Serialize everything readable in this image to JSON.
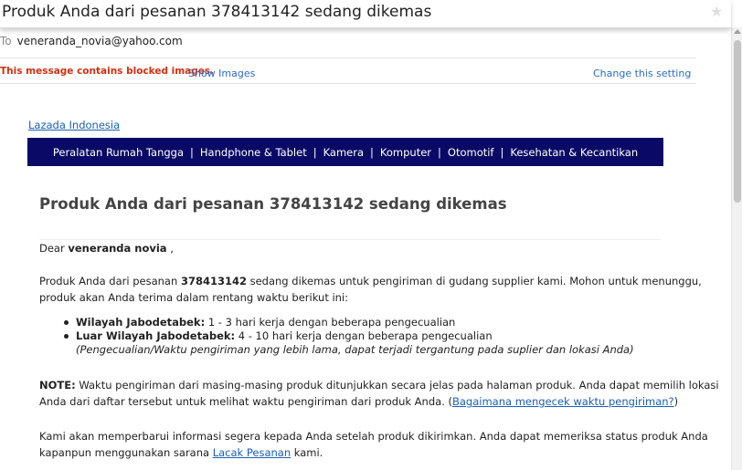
{
  "header": {
    "subject": "Produk Anda dari pesanan 378413142 sedang dikemas"
  },
  "meta": {
    "to_label": "To",
    "to_address": "veneranda_novia@yahoo.com",
    "blocked_message": "This message contains blocked images.",
    "show_images": "Show Images",
    "change_setting": "Change this setting"
  },
  "email": {
    "brand_link": "Lazada Indonesia",
    "nav": [
      "Peralatan Rumah Tangga",
      "Handphone & Tablet",
      "Kamera",
      "Komputer",
      "Otomotif",
      "Kesehatan & Kecantikan"
    ],
    "nav_separator": "|",
    "heading": "Produk Anda dari pesanan 378413142 sedang dikemas",
    "greeting_prefix": "Dear ",
    "greeting_name": "veneranda novia",
    "greeting_suffix": " ,",
    "para1_line1_a": "Produk Anda dari pesanan ",
    "para1_order": "378413142",
    "para1_line1_b": " sedang dikemas untuk pengiriman di gudang supplier kami. Mohon untuk menunggu,",
    "para1_line2": "produk akan Anda terima dalam rentang waktu berikut ini:",
    "bullet1_label": "Wilayah Jabodetabek:",
    "bullet1_text": " 1 - 3 hari kerja dengan beberapa pengecualian",
    "bullet2_label": "Luar Wilayah Jabodetabek:",
    "bullet2_text": " 4 - 10 hari kerja dengan beberapa pengecualian",
    "bullet_note": "(Pengecualian/Waktu pengiriman yang lebih lama, dapat terjadi tergantung pada suplier dan lokasi Anda)",
    "note_label": "NOTE:",
    "note_line1": " Waktu pengiriman dari masing-masing produk ditunjukkan secara jelas pada halaman produk. Anda dapat memilih lokasi",
    "note_line2_a": "Anda dari daftar tersebut untuk melihat waktu pengiriman dari produk Anda. (",
    "note_link": "Bagaimana mengecek waktu pengiriman?",
    "note_line2_b": ")",
    "para3_line1": "Kami akan memperbarui informasi segera kepada Anda setelah produk dikirimkan. Anda dapat memeriksa status produk Anda",
    "para3_line2_a": "kapanpun menggunakan sarana ",
    "para3_link": "Lacak Pesanan",
    "para3_line2_b": " kami."
  }
}
